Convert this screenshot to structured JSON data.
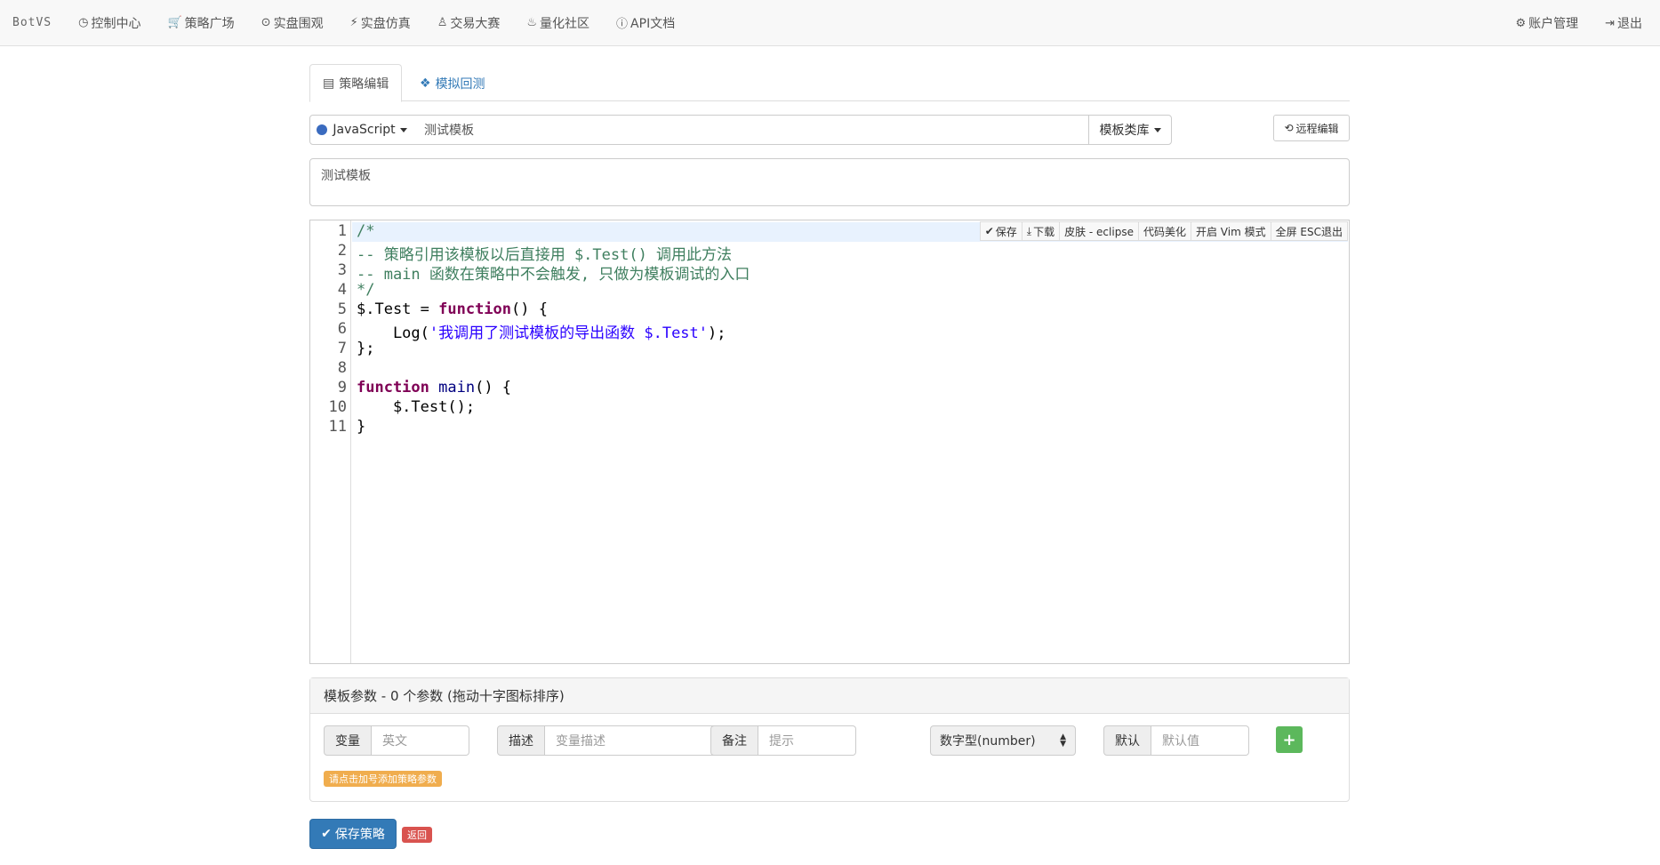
{
  "navbar": {
    "brand": "BotVS",
    "items": [
      {
        "icon": "clock-icon",
        "glyph": "◷",
        "label": "控制中心"
      },
      {
        "icon": "cart-icon",
        "glyph": "🛒",
        "label": "策略广场"
      },
      {
        "icon": "play-circle-icon",
        "glyph": "⊙",
        "label": "实盘围观"
      },
      {
        "icon": "bolt-icon",
        "glyph": "⚡",
        "label": "实盘仿真"
      },
      {
        "icon": "user-icon",
        "glyph": "♙",
        "label": "交易大赛"
      },
      {
        "icon": "fire-icon",
        "glyph": "♨",
        "label": "量化社区"
      },
      {
        "icon": "info-icon",
        "glyph": "ⓘ",
        "label": "API文档"
      }
    ],
    "right": [
      {
        "icon": "gear-icon",
        "glyph": "⚙",
        "label": "账户管理"
      },
      {
        "icon": "logout-icon",
        "glyph": "⇥",
        "label": "退出"
      }
    ]
  },
  "tabs": {
    "active": {
      "icon": "file-icon",
      "glyph": "▤",
      "label": "策略编辑"
    },
    "inactive": {
      "icon": "cubes-icon",
      "glyph": "❖",
      "label": "模拟回测"
    }
  },
  "toolbar": {
    "language": "JavaScript",
    "name_value": "测试模板",
    "library_label": "模板类库",
    "remote_label": "远程编辑",
    "remote_glyph": "⟲"
  },
  "description": "测试模板",
  "editor": {
    "buttons": [
      {
        "glyph": "✔",
        "label": "保存"
      },
      {
        "glyph": "⤓",
        "label": "下载"
      },
      {
        "glyph": "",
        "label": "皮肤 - eclipse"
      },
      {
        "glyph": "",
        "label": "代码美化"
      },
      {
        "glyph": "",
        "label": "开启 Vim 模式"
      },
      {
        "glyph": "",
        "label": "全屏 ESC退出"
      }
    ],
    "line_numbers": [
      "1",
      "2",
      "3",
      "4",
      "5",
      "6",
      "7",
      "8",
      "9",
      "10",
      "11"
    ]
  },
  "params": {
    "header": "模板参数 - 0 个参数 (拖动十字图标排序)",
    "var_label": "变量",
    "var_placeholder": "英文",
    "desc_label": "描述",
    "desc_placeholder": "变量描述",
    "note_label": "备注",
    "note_placeholder": "提示",
    "type_selected": "数字型(number)",
    "default_label": "默认",
    "default_placeholder": "默认值",
    "add_glyph": "+",
    "hint": "请点击加号添加策略参数"
  },
  "footer": {
    "save_label": "保存策略",
    "save_glyph": "✔",
    "back_label": "返回"
  }
}
